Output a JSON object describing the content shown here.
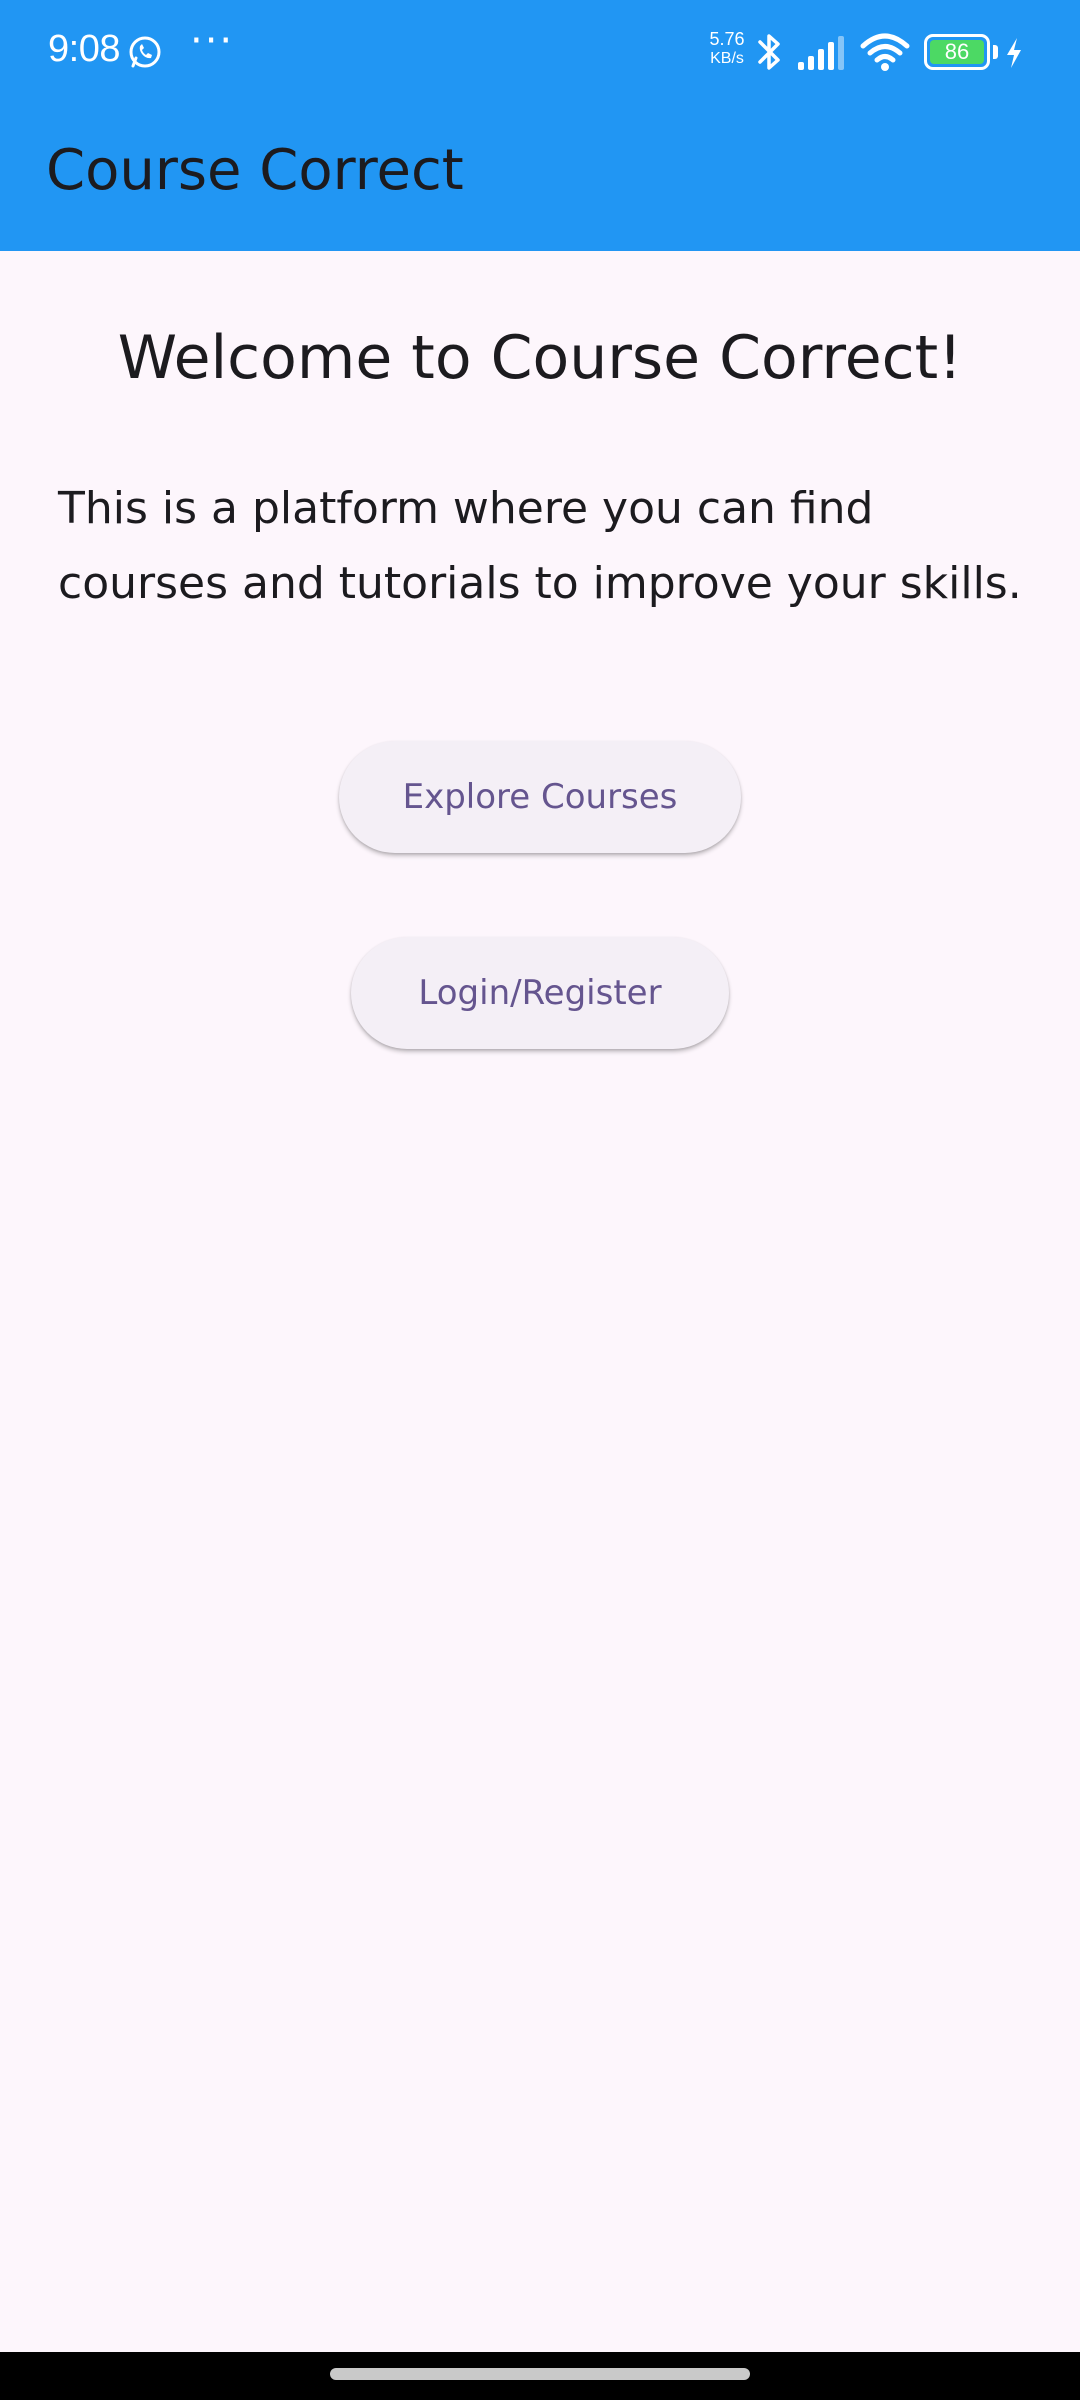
{
  "status_bar": {
    "time": "9:08",
    "more_indicator": "···",
    "net_speed_value": "5.76",
    "net_speed_unit": "KB/s",
    "battery_level": "86",
    "icons": [
      "whatsapp-icon",
      "bluetooth-icon",
      "signal-icon",
      "wifi-icon",
      "battery-icon",
      "charging-icon"
    ]
  },
  "app_bar": {
    "title": "Course Correct",
    "background_color": "#2196f3"
  },
  "main": {
    "welcome_title": "Welcome to Course Correct!",
    "intro_text": "This is a platform where you can find courses and tutorials to improve your skills.",
    "buttons": {
      "explore_label": "Explore Courses",
      "login_label": "Login/Register"
    },
    "accent_color": "#65558f",
    "background_color": "#fdf6fc"
  }
}
